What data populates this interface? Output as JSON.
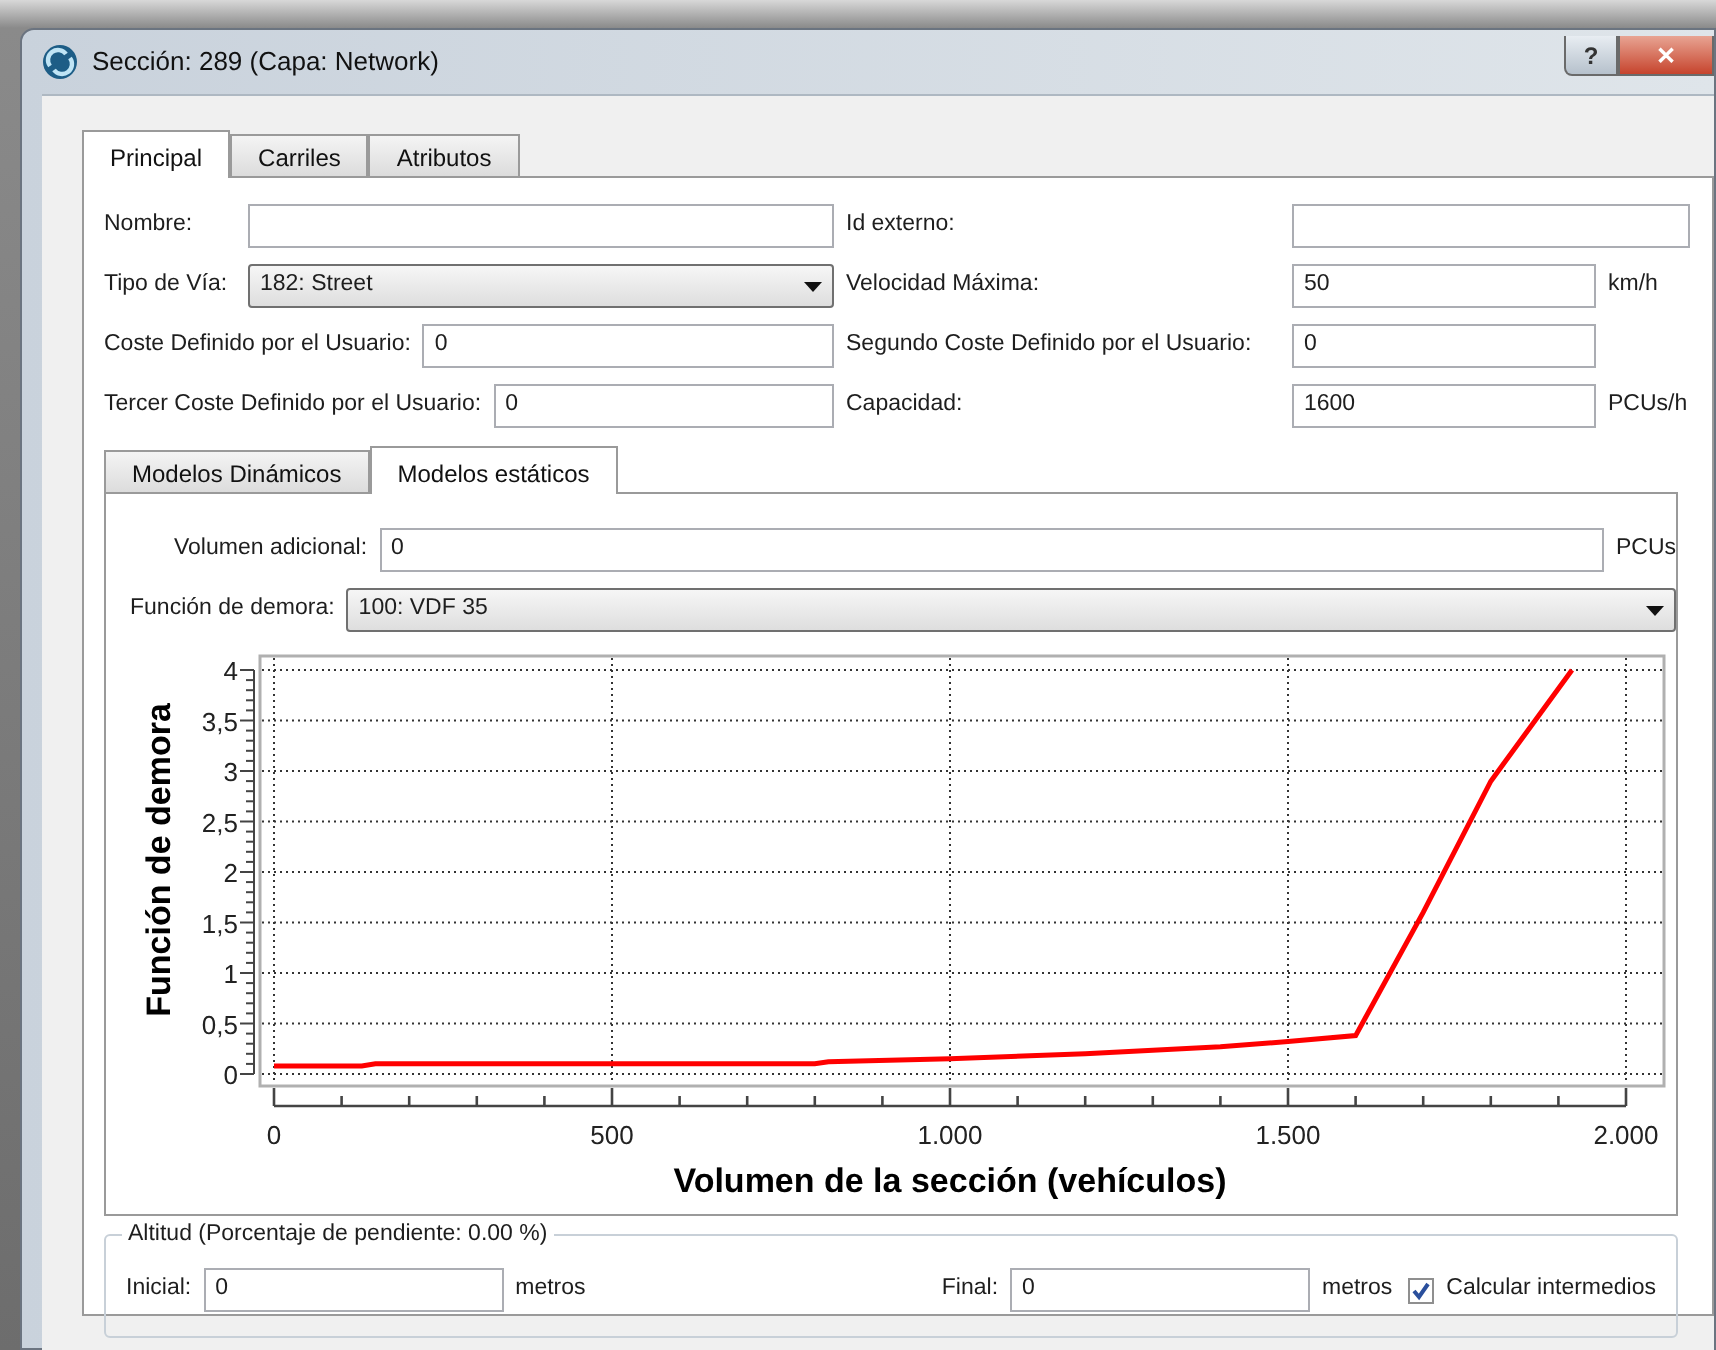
{
  "window": {
    "title": "Sección: 289 (Capa: Network)",
    "buttons": [
      {
        "kind": "help",
        "label": "?"
      },
      {
        "kind": "close",
        "label": "✕"
      }
    ]
  },
  "tabs": [
    {
      "label": "Principal",
      "selected": true
    },
    {
      "label": "Carriles",
      "selected": false
    },
    {
      "label": "Atributos",
      "selected": false
    }
  ],
  "form_rows": [
    {
      "left": {
        "label": "Nombre:",
        "kind": "text"
      },
      "right": {
        "label": "Id externo:",
        "kind": "text",
        "wide": true
      }
    },
    {
      "left": {
        "label": "Tipo de Vía:",
        "kind": "select",
        "value": "182: Street"
      },
      "right": {
        "label": "Velocidad Máxima:",
        "kind": "text",
        "value": "50",
        "unit": "km/h"
      }
    },
    {
      "left": {
        "label": "Coste Definido por el Usuario:",
        "kind": "text",
        "value": "0"
      },
      "right": {
        "label": "Segundo Coste Definido por el Usuario:",
        "kind": "text",
        "value": "0"
      }
    },
    {
      "left": {
        "label": "Tercer Coste Definido por el Usuario:",
        "kind": "text",
        "value": "0"
      },
      "right": {
        "label": "Capacidad:",
        "kind": "text",
        "value": "1600",
        "unit": "PCUs/h"
      }
    }
  ],
  "model_tabs": [
    {
      "label": "Modelos Dinámicos",
      "selected": false
    },
    {
      "label": "Modelos estáticos",
      "selected": true
    }
  ],
  "static_model": {
    "fields": [
      {
        "label": "Volumen adicional:",
        "kind": "text",
        "value": "0",
        "unit": "PCUs"
      },
      {
        "label": "Función de demora:",
        "kind": "select",
        "value": "100: VDF 35"
      }
    ],
    "chart_data": {
      "type": "line",
      "xlabel": "Volumen de la sección (vehículos)",
      "ylabel": "Función de demora",
      "grid": true,
      "xlim": [
        0,
        2000
      ],
      "ylim": [
        0,
        4
      ],
      "xticks": [
        {
          "value": 0,
          "label": "0"
        },
        {
          "value": 500,
          "label": "500"
        },
        {
          "value": 1000,
          "label": "1.000"
        },
        {
          "value": 1500,
          "label": "1.500"
        },
        {
          "value": 2000,
          "label": "2.000"
        }
      ],
      "yticks": [
        {
          "value": 0,
          "label": "0"
        },
        {
          "value": 0.5,
          "label": "0,5"
        },
        {
          "value": 1,
          "label": "1"
        },
        {
          "value": 1.5,
          "label": "1,5"
        },
        {
          "value": 2,
          "label": "2"
        },
        {
          "value": 2.5,
          "label": "2,5"
        },
        {
          "value": 3,
          "label": "3"
        },
        {
          "value": 3.5,
          "label": "3,5"
        },
        {
          "value": 4,
          "label": "4"
        }
      ],
      "x": [
        0,
        130,
        150,
        800,
        820,
        1000,
        1200,
        1400,
        1500,
        1600,
        1700,
        1800,
        1920
      ],
      "series": [
        {
          "color": "#ff0000",
          "values": [
            0.08,
            0.08,
            0.1,
            0.1,
            0.12,
            0.15,
            0.2,
            0.27,
            0.32,
            0.38,
            1.6,
            2.9,
            4.0
          ]
        }
      ]
    }
  },
  "altitude": {
    "title": "Altitud (Porcentaje de pendiente: 0.00 %)",
    "fields": [
      {
        "label": "Inicial:",
        "value": "0",
        "unit": "metros"
      },
      {
        "label": "Final:",
        "value": "0",
        "unit": "metros"
      }
    ],
    "checkbox": {
      "label": "Calcular intermedios",
      "checked": true
    }
  }
}
